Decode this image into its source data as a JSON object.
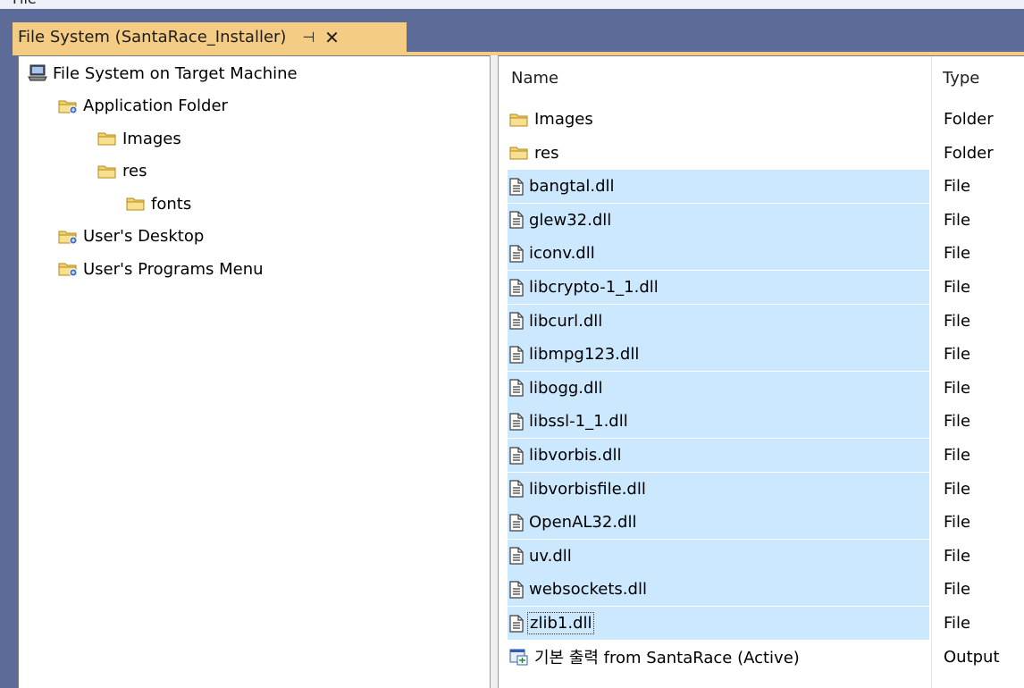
{
  "menu": {
    "file_label": "File"
  },
  "document_tab": {
    "title": "File System (SantaRace_Installer)",
    "pin_glyph": "⊣",
    "close_glyph": "✕"
  },
  "tree": {
    "root": {
      "label": "File System on Target Machine",
      "icon": "computer-icon"
    },
    "nodes": [
      {
        "label": "Application Folder",
        "icon": "special-folder-icon",
        "level": 1
      },
      {
        "label": "Images",
        "icon": "folder-icon",
        "level": 2
      },
      {
        "label": "res",
        "icon": "folder-icon",
        "level": 2
      },
      {
        "label": "fonts",
        "icon": "folder-icon",
        "level": 3
      },
      {
        "label": "User's Desktop",
        "icon": "special-folder-icon",
        "level": 1
      },
      {
        "label": "User's Programs Menu",
        "icon": "special-folder-icon",
        "level": 1
      }
    ]
  },
  "list": {
    "columns": {
      "name": "Name",
      "type": "Type"
    },
    "rows": [
      {
        "name": "Images",
        "type": "Folder",
        "icon": "folder-icon",
        "selected": false
      },
      {
        "name": "res",
        "type": "Folder",
        "icon": "folder-icon",
        "selected": false
      },
      {
        "name": "bangtal.dll",
        "type": "File",
        "icon": "file-icon",
        "selected": true
      },
      {
        "name": "glew32.dll",
        "type": "File",
        "icon": "file-icon",
        "selected": true
      },
      {
        "name": "iconv.dll",
        "type": "File",
        "icon": "file-icon",
        "selected": true
      },
      {
        "name": "libcrypto-1_1.dll",
        "type": "File",
        "icon": "file-icon",
        "selected": true
      },
      {
        "name": "libcurl.dll",
        "type": "File",
        "icon": "file-icon",
        "selected": true
      },
      {
        "name": "libmpg123.dll",
        "type": "File",
        "icon": "file-icon",
        "selected": true
      },
      {
        "name": "libogg.dll",
        "type": "File",
        "icon": "file-icon",
        "selected": true
      },
      {
        "name": "libssl-1_1.dll",
        "type": "File",
        "icon": "file-icon",
        "selected": true
      },
      {
        "name": "libvorbis.dll",
        "type": "File",
        "icon": "file-icon",
        "selected": true
      },
      {
        "name": "libvorbisfile.dll",
        "type": "File",
        "icon": "file-icon",
        "selected": true
      },
      {
        "name": "OpenAL32.dll",
        "type": "File",
        "icon": "file-icon",
        "selected": true
      },
      {
        "name": "uv.dll",
        "type": "File",
        "icon": "file-icon",
        "selected": true
      },
      {
        "name": "websockets.dll",
        "type": "File",
        "icon": "file-icon",
        "selected": true
      },
      {
        "name": "zlib1.dll",
        "type": "File",
        "icon": "file-icon",
        "selected": true,
        "focused": true
      },
      {
        "name": "기본 출력 from SantaRace (Active)",
        "type": "Output",
        "icon": "project-output-icon",
        "selected": false
      }
    ]
  },
  "colors": {
    "background": "#5d6b99",
    "active_tab": "#f5cc84",
    "selection": "#cce8ff",
    "folder_fill": "#f3d36b",
    "folder_edge": "#b48a1e"
  }
}
